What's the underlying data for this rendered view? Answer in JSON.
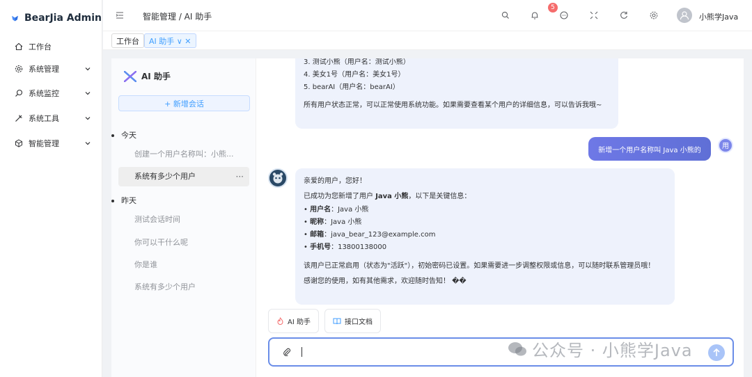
{
  "app": {
    "name": "BearJia Admin"
  },
  "sidebar": {
    "items": [
      {
        "label": "工作台",
        "icon": "home-icon"
      },
      {
        "label": "系统管理",
        "icon": "gear-icon"
      },
      {
        "label": "系统监控",
        "icon": "search-icon"
      },
      {
        "label": "系统工具",
        "icon": "tool-icon"
      },
      {
        "label": "智能管理",
        "icon": "cube-icon"
      }
    ]
  },
  "header": {
    "breadcrumb": "智能管理 / AI 助手",
    "notification_count": "5",
    "username": "小熊学Java"
  },
  "tags": [
    {
      "label": "工作台"
    },
    {
      "label": "AI 助手 ∨ ✕"
    }
  ],
  "conversations": {
    "title": "AI 助手",
    "new_button": "+ 新增会话",
    "groups": [
      {
        "label": "今天",
        "items": [
          "创建一个用户名称叫：小熊...",
          "系统有多少个用户"
        ]
      },
      {
        "label": "昨天",
        "items": [
          "测试会话时间",
          "你可以干什么呢",
          "你是谁",
          "系统有多少个用户"
        ]
      }
    ],
    "active_more": "···"
  },
  "chat": {
    "prev_ai": {
      "line_partial": "3. 测试小熊（用户名：测试小熊）",
      "line4": "4. 美女1号（用户名：美女1号）",
      "line5": "5. bearAI（用户名：bearAI）",
      "summary": "所有用户状态正常，可以正常使用系统功能。如果需要查看某个用户的详细信息，可以告诉我哦~"
    },
    "user_message": "新增一个用户名称叫 Java 小熊的",
    "user_avatar": "用",
    "ai_reply": {
      "greeting": "亲爱的用户，您好！",
      "intro_pre": "已成功为您新增了用户 ",
      "intro_name": "Java 小熊",
      "intro_post": "，以下是关键信息：",
      "fields": [
        {
          "k": "用户名",
          "v": "：Java 小熊"
        },
        {
          "k": "昵称",
          "v": "：Java 小熊"
        },
        {
          "k": "邮箱",
          "v": "：java_bear_123@example.com"
        },
        {
          "k": "手机号",
          "v": "：13800138000"
        }
      ],
      "note": "该用户已正常启用（状态为\"活跃\"），初始密码已设置。如果需要进一步调整权限或信息，可以随时联系管理员哦！",
      "thanks": "感谢您的使用，如有其他需求，欢迎随时告知！ ��"
    },
    "chips": [
      "AI 助手",
      "接口文档"
    ],
    "input": {
      "value": ""
    }
  },
  "watermark": "公众号 · 小熊学Java",
  "colors": {
    "accent": "#409eff",
    "badge": "#f56c6c",
    "user_bubble": "#6571e0",
    "ai_bubble": "#eef2fc"
  }
}
